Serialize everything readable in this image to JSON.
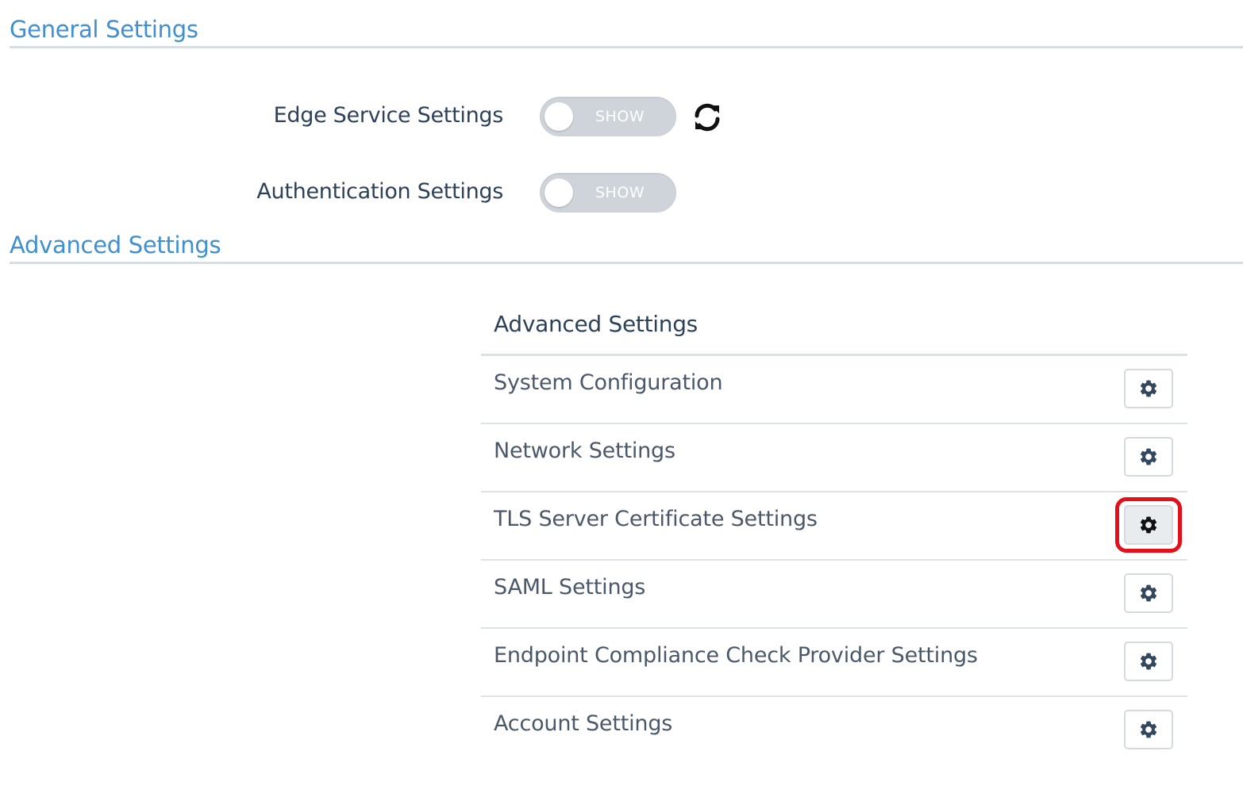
{
  "sections": {
    "general": {
      "title": "General Settings"
    },
    "advanced": {
      "title": "Advanced Settings"
    }
  },
  "general_settings": [
    {
      "label": "Edge Service Settings",
      "toggle_text": "SHOW",
      "toggle_on": false,
      "has_refresh": true
    },
    {
      "label": "Authentication Settings",
      "toggle_text": "SHOW",
      "toggle_on": false,
      "has_refresh": false
    }
  ],
  "advanced_table": {
    "header": "Advanced Settings",
    "rows": [
      {
        "label": "System Configuration",
        "icon": "gear-icon",
        "highlighted": false
      },
      {
        "label": "Network Settings",
        "icon": "gear-icon",
        "highlighted": false
      },
      {
        "label": "TLS Server Certificate Settings",
        "icon": "gear-icon",
        "highlighted": true
      },
      {
        "label": "SAML Settings",
        "icon": "gear-icon",
        "highlighted": false
      },
      {
        "label": "Endpoint Compliance Check Provider Settings",
        "icon": "gear-icon",
        "highlighted": false
      },
      {
        "label": "Account Settings",
        "icon": "gear-icon",
        "highlighted": false
      }
    ]
  },
  "colors": {
    "section_title": "#3f8fd2",
    "label_dark": "#2d4158",
    "toggle_bg": "#ced4da",
    "highlight": "#e3101a"
  },
  "icons": {
    "refresh": "refresh-icon",
    "gear": "gear-icon"
  }
}
